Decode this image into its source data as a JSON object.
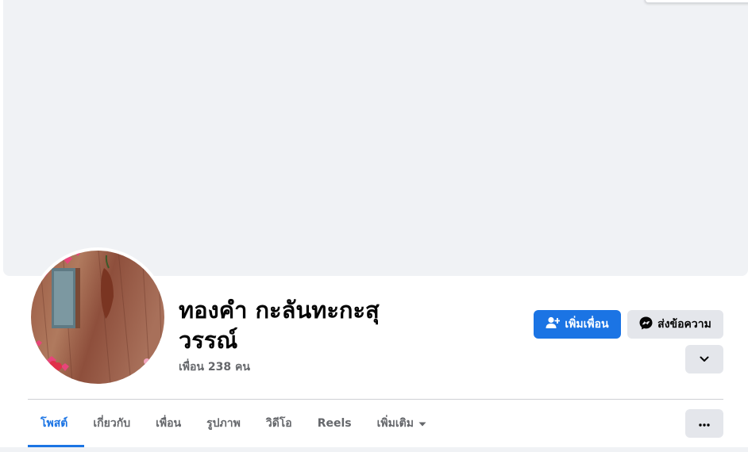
{
  "profile": {
    "name": "ทองคำ กะลันทะกะสุวรรณ์",
    "friends_count": "เพื่อน 238 คน"
  },
  "actions": {
    "add_friend": "เพิ่มเพื่อน",
    "message": "ส่งข้อความ",
    "add_friend_icon": "person-add-icon",
    "message_icon": "messenger-icon",
    "expand_icon": "chevron-down-icon",
    "more_icon": "ellipsis-icon"
  },
  "tabs": [
    {
      "label": "โพสต์",
      "active": true
    },
    {
      "label": "เกี่ยวกับ"
    },
    {
      "label": "เพื่อน"
    },
    {
      "label": "รูปภาพ"
    },
    {
      "label": "วิดีโอ"
    },
    {
      "label": "Reels"
    },
    {
      "label": "เพิ่มเติม"
    }
  ],
  "colors": {
    "accent": "#1b74e4",
    "cover_bg": "#f0f2f5",
    "secondary_button": "#e4e6eb",
    "secondary_text": "#65676b"
  }
}
